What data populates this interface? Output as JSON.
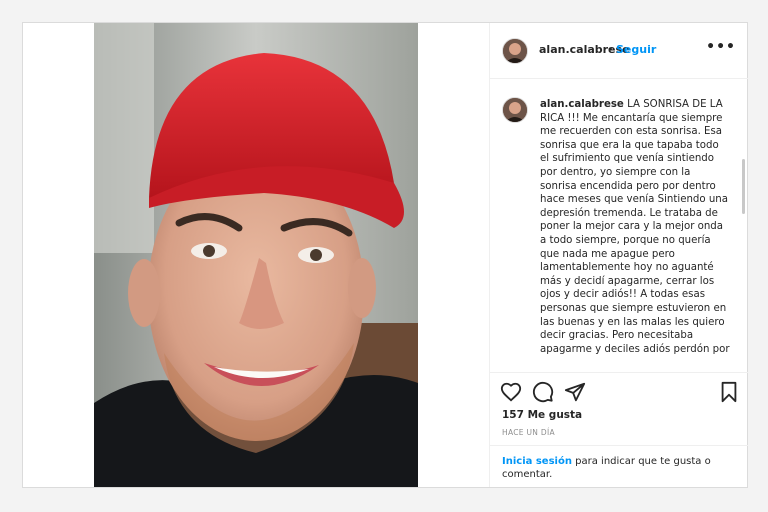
{
  "post": {
    "username": "alan.calabrese",
    "dot": "•",
    "follow_label": "Seguir",
    "more_label": "•••",
    "caption_user": "alan.calabrese",
    "caption_text": "LA SONRISA DE LA RICA !!! Me encantaría que siempre me recuerden con esta sonrisa. Esa sonrisa que era la que tapaba todo el sufrimiento que venía sintiendo por dentro, yo siempre con la sonrisa encendida pero por dentro hace meses que venía Sintiendo una depresión tremenda. Le trataba de poner la mejor cara y la mejor onda a todo siempre, porque no quería que nada me apague pero lamentablemente hoy no aguanté más y decidí apagarme, cerrar los ojos y decir adiós!! A todas esas personas que siempre estuvieron en las buenas y en las malas les quiero decir gracias. Pero necesitaba apagarme y deciles adiós perdón por",
    "likes": "157 Me gusta",
    "date": "HACE UN DÍA",
    "login_link": "Inicia sesión",
    "login_text": " para indicar que te gusta o comentar."
  },
  "icons": {
    "like": "heart-icon",
    "comment": "comment-icon",
    "share": "share-icon",
    "save": "bookmark-icon",
    "more": "more-options-icon"
  },
  "colors": {
    "accent": "#0095f6",
    "cap_red": "#d8202a"
  }
}
